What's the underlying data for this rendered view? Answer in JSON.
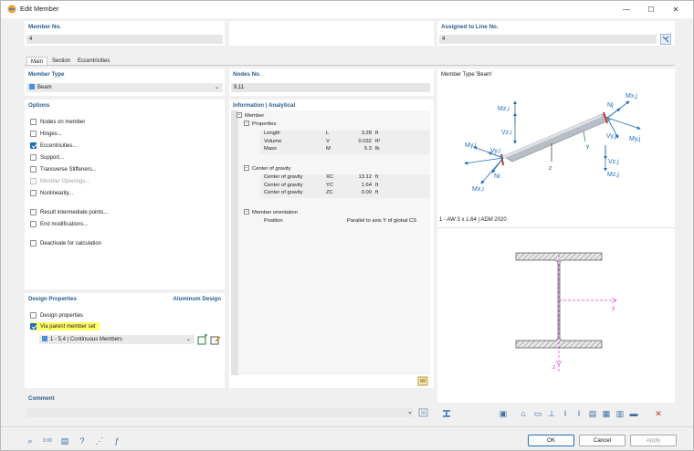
{
  "window": {
    "title": "Edit Member",
    "minimize_glyph": "—",
    "maximize_glyph": "☐",
    "close_glyph": "✕"
  },
  "header": {
    "member_no_label": "Member No.",
    "member_no_value": "4",
    "assigned_label": "Assigned to Line No.",
    "assigned_value": "4"
  },
  "tabs": [
    {
      "label": "Main"
    },
    {
      "label": "Section"
    },
    {
      "label": "Eccentricities"
    }
  ],
  "member_type": {
    "label": "Member Type",
    "value": "Beam",
    "accent": "#4a90d9"
  },
  "nodes": {
    "label": "Nodes No.",
    "value": "9,11"
  },
  "options": {
    "label": "Options",
    "items": [
      {
        "label": "Nodes on member",
        "checked": false,
        "disabled": false
      },
      {
        "label": "Hinges...",
        "checked": false,
        "disabled": false
      },
      {
        "label": "Eccentricities...",
        "checked": true,
        "disabled": false
      },
      {
        "label": "Support...",
        "checked": false,
        "disabled": false
      },
      {
        "label": "Transverse Stiffeners...",
        "checked": false,
        "disabled": false
      },
      {
        "label": "Member Openings...",
        "checked": false,
        "disabled": true
      },
      {
        "label": "Nonlinearity...",
        "checked": false,
        "disabled": false
      },
      {
        "label": "Result intermediate points...",
        "checked": false,
        "disabled": false
      },
      {
        "label": "End modifications...",
        "checked": false,
        "disabled": false
      },
      {
        "label": "Deactivate for calculation",
        "checked": false,
        "disabled": false
      }
    ]
  },
  "design": {
    "label": "Design Properties",
    "addon": "Aluminum Design",
    "design_properties": "Design properties",
    "via_parent": "Via parent member set",
    "member_set": "1 - 5,4 | Continuous Members",
    "highlight": "#ffff66"
  },
  "info": {
    "label": "Information | Analytical",
    "root": "Member",
    "properties_label": "Properties",
    "properties": [
      {
        "name": "Length",
        "symbol": "L",
        "value": "3.28",
        "unit": "ft"
      },
      {
        "name": "Volume",
        "symbol": "V",
        "value": "0.032",
        "unit": "ft³"
      },
      {
        "name": "Mass",
        "symbol": "M",
        "value": "5.3",
        "unit": "lb"
      }
    ],
    "cog_label": "Center of gravity",
    "cog": [
      {
        "name": "Center of gravity",
        "symbol": "XC",
        "value": "13.12",
        "unit": "ft"
      },
      {
        "name": "Center of gravity",
        "symbol": "YC",
        "value": "1.64",
        "unit": "ft"
      },
      {
        "name": "Center of gravity",
        "symbol": "ZC",
        "value": "0.00",
        "unit": "ft"
      }
    ],
    "orientation_label": "Member orientation",
    "position_name": "Position",
    "position_value": "Parallel to axis Y of global CS"
  },
  "preview": {
    "member_type_caption": "Member Type 'Beam'",
    "section_caption": "1 - AW 3 x 1.64 | ADM 2020",
    "labels": {
      "mxj": "Mx,j",
      "nj_top": "Nj",
      "mzi": "Mz,i",
      "vzi": "Vz,i",
      "vyj": "Vy,j",
      "myj": "My,j",
      "myi": "My,i",
      "vyi": "Vy,i",
      "ni": "Ni",
      "mxi": "Mx,i",
      "z": "z",
      "y": "y",
      "vzj": "Vz,j",
      "mzj": "Mz,j",
      "sec_y": "y",
      "sec_z": "z"
    },
    "colors": {
      "arrow": "#1f6fb5",
      "beam": "#9aa3ad",
      "end": "#c0392b",
      "axis": "#d63ad6",
      "hatch": "#7a7a7a"
    }
  },
  "comment": {
    "label": "Comment",
    "value": ""
  },
  "buttons": {
    "ok": "OK",
    "cancel": "Cancel",
    "apply": "Apply"
  },
  "icons": {
    "bottom_toolbar": [
      "search-icon",
      "units-icon",
      "table-icon",
      "help-icon",
      "nodes-icon",
      "formula-icon"
    ],
    "preview_toolbar": [
      "section-view-icon",
      "print-icon",
      "frame-icon",
      "dimension-icon",
      "text-icon",
      "text-alt-icon",
      "grid-icon",
      "fill-icon",
      "stripe-icon",
      "printer-icon",
      "reset-icon"
    ]
  }
}
